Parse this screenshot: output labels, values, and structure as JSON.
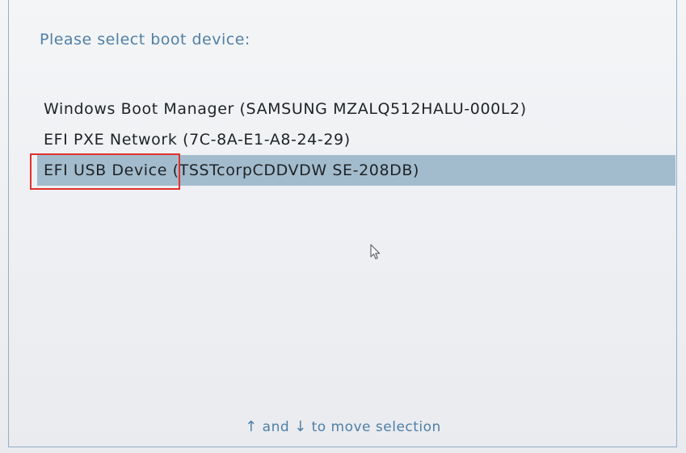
{
  "screen": {
    "title": "Please select boot device:",
    "accent_color": "#4f7fa6",
    "selection_color": "#a3bccd",
    "annotation_color": "#e0302c"
  },
  "boot_devices": [
    {
      "label": "Windows Boot Manager (SAMSUNG MZALQ512HALU-000L2)",
      "selected": false
    },
    {
      "label": "EFI PXE Network (7C-8A-E1-A8-24-29)",
      "selected": false
    },
    {
      "label": "EFI USB Device (TSSTcorpCDDVDW SE-208DB)",
      "selected": true
    }
  ],
  "footer": {
    "up_arrow": "↑",
    "and_text": "and",
    "down_arrow": "↓",
    "move_text": "to move selection"
  },
  "icons": {
    "cursor": "mouse-pointer-icon"
  }
}
